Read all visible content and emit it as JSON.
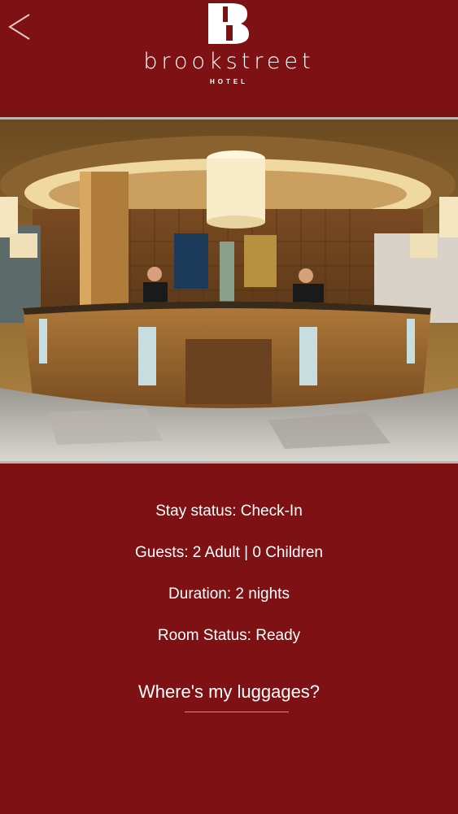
{
  "header": {
    "back_icon": "back-arrow-icon",
    "logo_letter": "B",
    "brand_name": "brookstreet",
    "brand_sub": "HOTEL"
  },
  "hero": {
    "description_icon": "hotel-lobby-image"
  },
  "stay": {
    "status": "Stay status: Check-In",
    "guests": "Guests:  2 Adult | 0 Children",
    "duration": "Duration: 2  nights",
    "room_status": "Room Status: Ready"
  },
  "actions": {
    "luggage_link": "Where's my luggages?"
  },
  "colors": {
    "background": "#7e1113",
    "text": "#ffffff"
  }
}
